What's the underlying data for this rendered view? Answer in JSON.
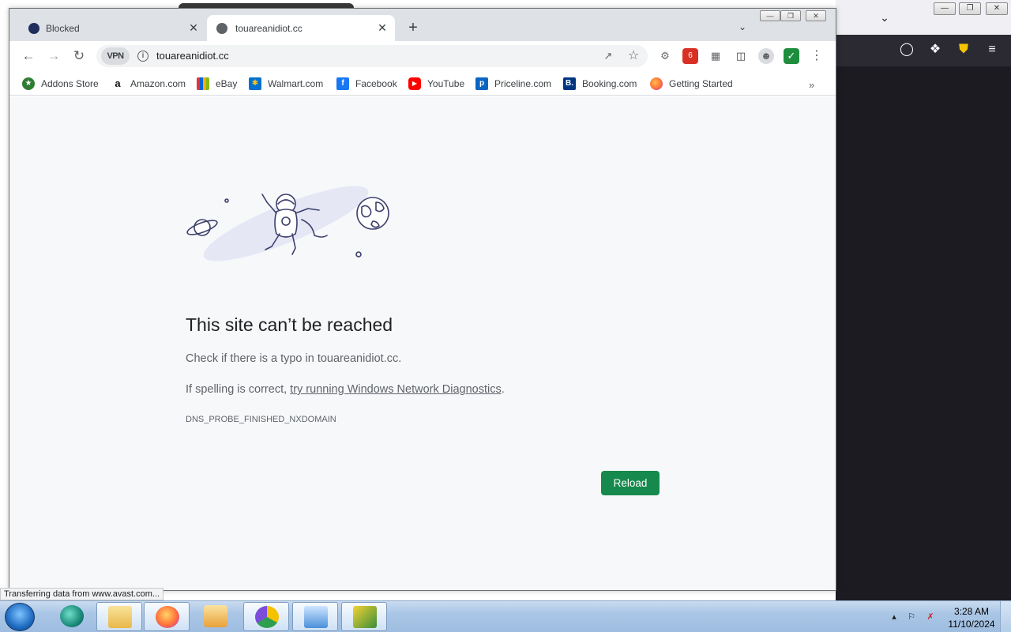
{
  "chrome": {
    "tabs": [
      {
        "title": "Blocked",
        "active": false
      },
      {
        "title": "touareanidiot.cc",
        "active": true
      }
    ],
    "url": "touareanidiot.cc",
    "vpn_label": "VPN",
    "bookmarks": [
      {
        "label": "Addons Store",
        "icon": "addons-store-icon",
        "color": "#2e7d32"
      },
      {
        "label": "Amazon.com",
        "icon": "amazon-icon",
        "color": "#111111"
      },
      {
        "label": "eBay",
        "icon": "ebay-icon",
        "color": "#e53238"
      },
      {
        "label": "Walmart.com",
        "icon": "walmart-icon",
        "color": "#0071ce"
      },
      {
        "label": "Facebook",
        "icon": "facebook-icon",
        "color": "#1877f2"
      },
      {
        "label": "YouTube",
        "icon": "youtube-icon",
        "color": "#ff0000"
      },
      {
        "label": "Priceline.com",
        "icon": "priceline-icon",
        "color": "#0a66c2"
      },
      {
        "label": "Booking.com",
        "icon": "booking-icon",
        "color": "#003580"
      },
      {
        "label": "Getting Started",
        "icon": "firefox-icon",
        "color": "#ff7139"
      }
    ]
  },
  "error_page": {
    "title": "This site can’t be reached",
    "line1": "Check if there is a typo in touareanidiot.cc.",
    "line2_prefix": "If spelling is correct, ",
    "line2_link": "try running Windows Network Diagnostics",
    "line2_suffix": ".",
    "error_code": "DNS_PROBE_FINISHED_NXDOMAIN",
    "reload_label": "Reload",
    "reload_color": "#168a4d"
  },
  "status_bar": "Transferring data from www.avast.com...",
  "taskbar": {
    "time": "3:28 AM",
    "date": "11/10/2024"
  }
}
